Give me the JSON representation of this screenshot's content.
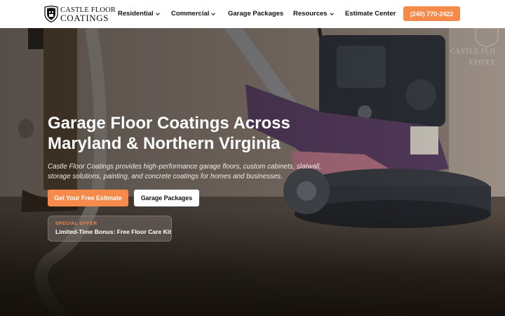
{
  "brand": {
    "logo_line1": "CASTLE FLOOR",
    "logo_line2": "COATINGS",
    "accent_color": "#f58a4b"
  },
  "nav": {
    "items": [
      {
        "label": "Residential",
        "dropdown": true
      },
      {
        "label": "Commercial",
        "dropdown": true
      },
      {
        "label": "Garage Packages",
        "dropdown": false
      },
      {
        "label": "Resources",
        "dropdown": true
      },
      {
        "label": "Estimate Center",
        "dropdown": false
      }
    ],
    "phone_label": "(240) 770-2422"
  },
  "hero": {
    "headline": "Garage Floor Coatings Across Maryland & Northern Virginia",
    "subtext": "Castle Floor Coatings provides high-performance garage floors, custom cabinets, slatwall, storage solutions, painting, and concrete coatings for homes and businesses.",
    "primary_cta": "Get Your Free Estimate",
    "secondary_cta": "Garage Packages",
    "offer_tag": "SPECIAL OFFER",
    "offer_title": "Limited-Time Bonus: Free Floor Care Kit",
    "watermark_line1": "CASTLE FLO",
    "watermark_line2": "EPOXY"
  },
  "icons": [
    "castle-shield-logo-icon",
    "chevron-down-icon"
  ]
}
